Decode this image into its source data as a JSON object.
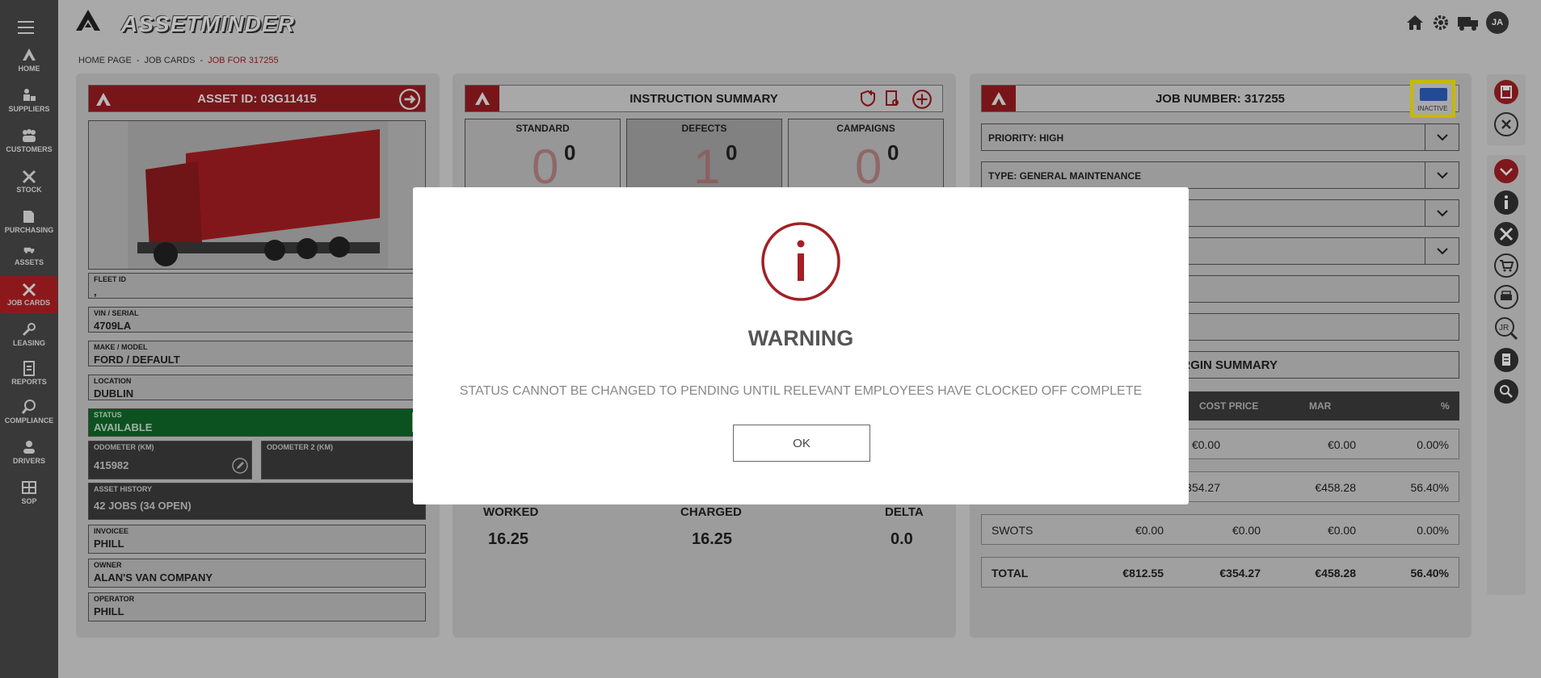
{
  "app": {
    "logo_text": "ASSETMINDER",
    "user_initials": "JA"
  },
  "sidebar": {
    "items": [
      {
        "label": "HOME",
        "icon": "home-logo-icon"
      },
      {
        "label": "SUPPLIERS",
        "icon": "suppliers-icon"
      },
      {
        "label": "CUSTOMERS",
        "icon": "customers-icon"
      },
      {
        "label": "STOCK",
        "icon": "stock-icon"
      },
      {
        "label": "PURCHASING",
        "icon": "purchasing-icon"
      },
      {
        "label": "ASSETS",
        "icon": "assets-icon"
      },
      {
        "label": "JOB CARDS",
        "icon": "job-cards-icon",
        "active": true
      },
      {
        "label": "LEASING",
        "icon": "leasing-icon"
      },
      {
        "label": "REPORTS",
        "icon": "reports-icon"
      },
      {
        "label": "COMPLIANCE",
        "icon": "compliance-icon"
      },
      {
        "label": "DRIVERS",
        "icon": "drivers-icon"
      },
      {
        "label": "SOP",
        "icon": "sop-icon"
      }
    ]
  },
  "breadcrumb": {
    "home": "HOME PAGE",
    "sep": "-",
    "job_cards": "JOB CARDS",
    "current": "JOB FOR 317255"
  },
  "asset_panel": {
    "title": "ASSET ID: 03G11415",
    "fields": {
      "fleet_id": {
        "label": "FLEET ID",
        "value": ","
      },
      "vin": {
        "label": "VIN / SERIAL",
        "value": "4709LA"
      },
      "make_model": {
        "label": "MAKE / MODEL",
        "value": "FORD / DEFAULT"
      },
      "location": {
        "label": "LOCATION",
        "value": "DUBLIN"
      },
      "status": {
        "label": "STATUS",
        "value": "AVAILABLE"
      },
      "odometer": {
        "label": "ODOMETER (KM)",
        "value": "415982"
      },
      "odometer2": {
        "label": "ODOMETER 2 (KM)",
        "value": ""
      },
      "history": {
        "label": "ASSET HISTORY",
        "value": "42 JOBS (34 OPEN)"
      },
      "invoicee": {
        "label": "INVOICEE",
        "value": "PHILL"
      },
      "owner": {
        "label": "OWNER",
        "value": "ALAN'S VAN COMPANY"
      },
      "operator": {
        "label": "OPERATOR",
        "value": "PHILL"
      }
    }
  },
  "instruction_panel": {
    "title": "INSTRUCTION SUMMARY",
    "boxes": [
      {
        "label": "STANDARD",
        "count": "0",
        "big": "0"
      },
      {
        "label": "DEFECTS",
        "count": "0",
        "big": "1"
      },
      {
        "label": "CAMPAIGNS",
        "count": "0",
        "big": "0"
      }
    ],
    "stats": {
      "worked_label": "WORKED",
      "worked_value": "16.25",
      "charged_label": "CHARGED",
      "charged_value": "16.25",
      "delta_label": "DELTA",
      "delta_value": "0.0"
    }
  },
  "job_panel": {
    "title": "JOB NUMBER: 317255",
    "status_toggle": "INACTIVE",
    "priority": "PRIORITY: HIGH",
    "type": "TYPE: GENERAL MAINTENANCE",
    "margin_title": "MARGIN SUMMARY",
    "table_headers": [
      "COST PRICE",
      "MAR",
      "%"
    ],
    "rows": [
      {
        "name": "",
        "sell": "",
        "cost": "€0.00",
        "margin": "€0.00",
        "pct": "0.00%"
      },
      {
        "name": "",
        "sell": "",
        "cost": "€354.27",
        "margin": "€458.28",
        "pct": "56.40%"
      },
      {
        "name": "SWOTS",
        "sell": "€0.00",
        "cost": "€0.00",
        "margin": "€0.00",
        "pct": "0.00%"
      },
      {
        "name": "TOTAL",
        "sell": "€812.55",
        "cost": "€354.27",
        "margin": "€458.28",
        "pct": "56.40%"
      }
    ]
  },
  "modal": {
    "title": "WARNING",
    "message": "STATUS CANNOT BE CHANGED TO PENDING UNTIL RELEVANT EMPLOYEES HAVE CLOCKED OFF COMPLETE",
    "ok_label": "OK",
    "icon": "info-icon",
    "accent": "#a31f24"
  }
}
